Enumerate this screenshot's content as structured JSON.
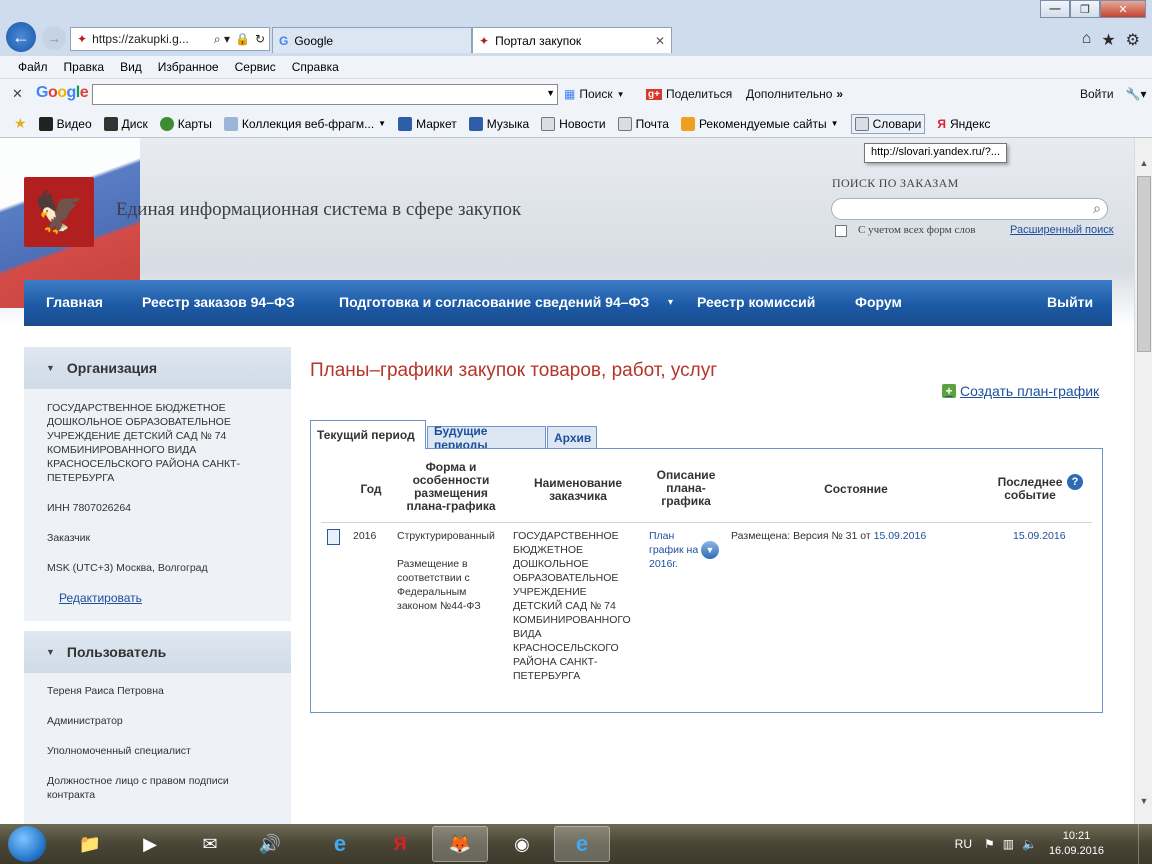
{
  "browser": {
    "url": "https://zakupki.g...",
    "tabs": [
      {
        "label": "Google"
      },
      {
        "label": "Портал закупок"
      }
    ],
    "menu": [
      "Файл",
      "Правка",
      "Вид",
      "Избранное",
      "Сервис",
      "Справка"
    ],
    "google_bar": {
      "search_label": "Поиск",
      "share_label": "Поделиться",
      "more_label": "Дополнительно",
      "signin_label": "Войти"
    },
    "favorites": [
      "Видео",
      "Диск",
      "Карты",
      "Коллекция веб-фрагм...",
      "Маркет",
      "Музыка",
      "Новости",
      "Почта",
      "Рекомендуемые сайты",
      "Словари",
      "Яндекс"
    ],
    "tooltip": "http://slovari.yandex.ru/?..."
  },
  "site": {
    "title": "Единая информационная система в сфере закупок",
    "search_label": "ПОИСК ПО ЗАКАЗАМ",
    "search_value": "",
    "checkbox_label": "С учетом всех форм слов",
    "advanced_link": "Расширенный поиск",
    "nav": [
      "Главная",
      "Реестр заказов 94–ФЗ",
      "Подготовка и согласование сведений 94–ФЗ",
      "Реестр комиссий",
      "Форум",
      "Выйти"
    ]
  },
  "sidebar": {
    "org": {
      "title": "Организация",
      "name": "ГОСУДАРСТВЕННОЕ БЮДЖЕТНОЕ ДОШКОЛЬНОЕ ОБРАЗОВАТЕЛЬНОЕ УЧРЕЖДЕНИЕ ДЕТСКИЙ САД № 74 КОМБИНИРОВАННОГО ВИДА КРАСНОСЕЛЬСКОГО РАЙОНА САНКТ-ПЕТЕРБУРГА",
      "inn": "ИНН 7807026264",
      "role": "Заказчик",
      "tz": "MSK (UTC+3) Москва, Волгоград",
      "edit_link": "Редактировать"
    },
    "user": {
      "title": "Пользователь",
      "name": "Тереня Раиса Петровна",
      "roles": [
        "Администратор",
        "Уполномоченный специалист",
        "Должностное лицо с правом подписи контракта"
      ]
    }
  },
  "main": {
    "heading": "Планы–графики закупок товаров, работ, услуг",
    "create_link": "Создать план-график",
    "tabs": [
      "Текущий период",
      "Будущие периоды",
      "Архив"
    ],
    "columns": {
      "year": "Год",
      "form": "Форма и особенности размещения плана-графика",
      "customer": "Наименование заказчика",
      "description": "Описание плана-графика",
      "state": "Состояние",
      "last_event": "Последнее событие"
    },
    "row": {
      "year": "2016",
      "form_type": "Структурированный",
      "form_note": "Размещение в соответствии с Федеральным законом №44-ФЗ",
      "customer": "ГОСУДАРСТВЕННОЕ БЮДЖЕТНОЕ ДОШКОЛЬНОЕ ОБРАЗОВАТЕЛЬНОЕ УЧРЕЖДЕНИЕ ДЕТСКИЙ САД № 74 КОМБИНИРОВАННОГО ВИДА КРАСНОСЕЛЬСКОГО РАЙОНА САНКТ-ПЕТЕРБУРГА",
      "description_link": "План график на 2016г.",
      "state_prefix": "Размещена: Версия №  31 от",
      "state_date": "15.09.2016",
      "last_event": "15.09.2016"
    }
  },
  "taskbar": {
    "lang": "RU",
    "time": "10:21",
    "date": "16.09.2016"
  }
}
